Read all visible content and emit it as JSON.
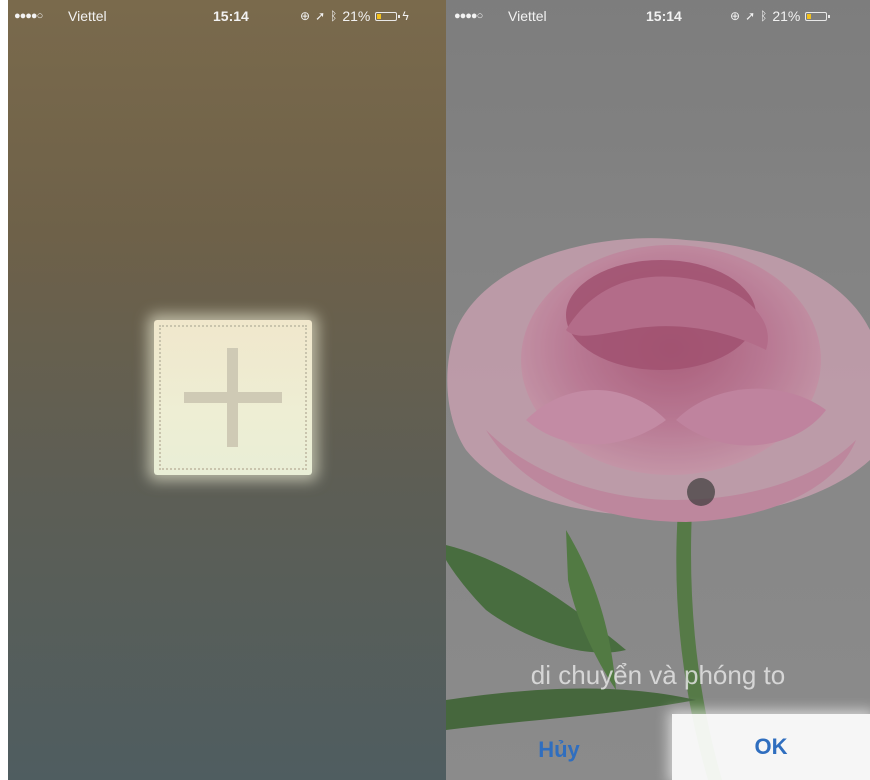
{
  "left_screen": {
    "status_bar": {
      "signal": "●●●●○",
      "carrier": "Viettel",
      "time": "15:14",
      "battery": "21%"
    }
  },
  "right_screen": {
    "status_bar": {
      "signal": "●●●●○",
      "carrier": "Viettel",
      "time": "15:14",
      "battery": "21%"
    },
    "hint": "di chuyển và phóng to",
    "cancel_label": "Hủy",
    "ok_label": "OK"
  },
  "colors": {
    "accent": "#2f6ebf",
    "battery": "#f3c21d"
  },
  "icons": [
    "location-lock-icon",
    "location-arrow-icon",
    "bluetooth-icon",
    "battery-icon",
    "charging-icon",
    "plus-icon"
  ]
}
